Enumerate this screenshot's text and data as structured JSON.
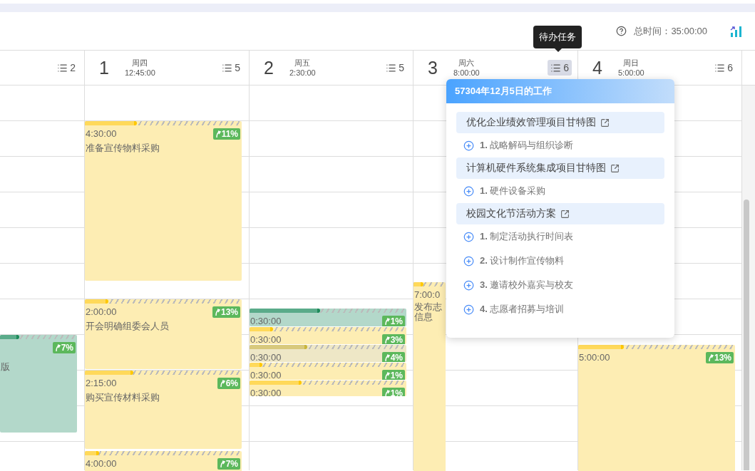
{
  "toolbar": {
    "total_time": "总时间：35:00:00"
  },
  "tooltip": "待办任务",
  "days": [
    {
      "count": "2",
      "selected": false,
      "events": [
        {
          "color": "#b3d8ca",
          "title": "版",
          "badge": "7%",
          "level": 0.25
        }
      ]
    },
    {
      "number": "1",
      "weekday": "周四",
      "hours": "12:45:00",
      "count": "5",
      "selected": false,
      "events": [
        {
          "color": "#fdedb3",
          "time": "4:30:00",
          "title": "准备宣传物料采购",
          "badge": "11%",
          "level": 0.33
        },
        {
          "color": "#fdedb3",
          "time": "2:00:00",
          "title": "开会明确组委会人员",
          "badge": "13%",
          "level": 0.15
        },
        {
          "color": "#fdedb3",
          "time": "2:15:00",
          "title": "购买宣传材料采购",
          "badge": "6%",
          "level": 0.31
        },
        {
          "color": "#fdedb3",
          "time": "4:00:00",
          "badge": "7%",
          "level": 0.09
        }
      ]
    },
    {
      "number": "2",
      "weekday": "周五",
      "hours": "2:30:00",
      "count": "5",
      "selected": false,
      "events": [
        {
          "color": "#b3d8ca",
          "time": "0:30:00",
          "badge": "1%",
          "level": 0.45
        },
        {
          "color": "#fdedb3",
          "time": "0:30:00",
          "badge": "3%",
          "level": 0.15
        },
        {
          "color": "#eee7c6",
          "time": "0:30:00",
          "badge": "4%",
          "level": 0.37
        },
        {
          "color": "#fdedb3",
          "time": "0:30:00",
          "badge": "1%",
          "level": 0.08
        },
        {
          "color": "#fdedb3",
          "time": "0:30:00",
          "badge": "1%",
          "level": 0.33
        }
      ]
    },
    {
      "number": "3",
      "weekday": "周六",
      "hours": "8:00:00",
      "count": "6",
      "selected": true,
      "events": [
        {
          "color": "#fdedb3",
          "time": "7:00:0",
          "title_lines": [
            "发布志",
            "信息"
          ],
          "level": 0.3
        }
      ]
    },
    {
      "number": "4",
      "weekday": "周日",
      "hours": "5:00:00",
      "count": "6",
      "selected": false,
      "events": [
        {
          "color": "#fdedb3",
          "time": "5:00:00",
          "badge": "13%",
          "level": 0.29
        }
      ]
    }
  ],
  "popup": {
    "title": "57304年12月5日的工作",
    "groups": [
      {
        "project": "优化企业绩效管理项目甘特图",
        "tasks": [
          "**1.** 战略解码与组织诊断"
        ]
      },
      {
        "project": "计算机硬件系统集成项目甘特图",
        "tasks": [
          "**1.** 硬件设备采购"
        ]
      },
      {
        "project": "校园文化节活动方案",
        "tasks": [
          "**1.** 制定活动执行时间表",
          "**2.** 设计制作宣传物料",
          "**3.** 邀请校外嘉宾与校友",
          "**4.** 志愿者招募与培训"
        ]
      }
    ]
  }
}
